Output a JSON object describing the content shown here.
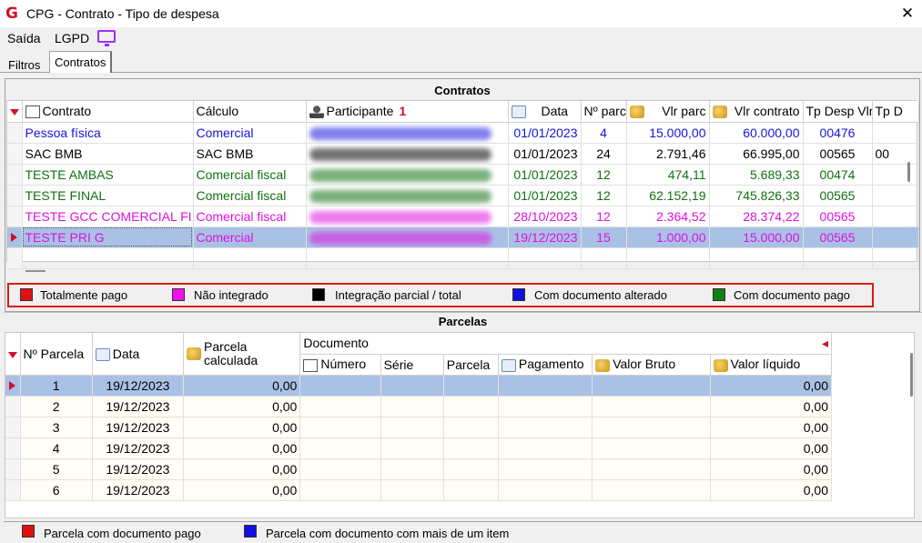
{
  "window": {
    "title": "CPG - Contrato - Tipo de despesa",
    "close_glyph": "✕",
    "logo_glyph": "G"
  },
  "menu": {
    "saida": "Saída",
    "lgpd": "LGPD"
  },
  "tabs": {
    "filtros": "Filtros",
    "contratos": "Contratos"
  },
  "contratos": {
    "title": "Contratos",
    "columns": [
      "Contrato",
      "Cálculo",
      "Participante",
      "Data",
      "Nº parc",
      "Vlr parc",
      "Vlr contrato",
      "Tp Desp Vlr",
      "Tp D"
    ],
    "sort_marker": "1",
    "rows": [
      {
        "contrato": "Pessoa física",
        "calculo": "Comercial",
        "data": "01/01/2023",
        "nparc": "4",
        "vlr_parc": "15.000,00",
        "vlr_contrato": "60.000,00",
        "tp_desp": "00476",
        "tp_d": "",
        "color": "#1515e0"
      },
      {
        "contrato": "SAC BMB",
        "calculo": "SAC BMB",
        "data": "01/01/2023",
        "nparc": "24",
        "vlr_parc": "2.791,46",
        "vlr_contrato": "66.995,00",
        "tp_desp": "00565",
        "tp_d": "00",
        "color": "#000000"
      },
      {
        "contrato": "TESTE AMBAS",
        "calculo": "Comercial fiscal",
        "data": "01/01/2023",
        "nparc": "12",
        "vlr_parc": "474,11",
        "vlr_contrato": "5.689,33",
        "tp_desp": "00474",
        "tp_d": "",
        "color": "#107010"
      },
      {
        "contrato": "TESTE FINAL",
        "calculo": "Comercial fiscal",
        "data": "01/01/2023",
        "nparc": "12",
        "vlr_parc": "62.152,19",
        "vlr_contrato": "745.826,33",
        "tp_desp": "00565",
        "tp_d": "",
        "color": "#107010"
      },
      {
        "contrato": "TESTE GCC COMERCIAL FI...",
        "calculo": "Comercial fiscal",
        "data": "28/10/2023",
        "nparc": "12",
        "vlr_parc": "2.364,52",
        "vlr_contrato": "28.374,22",
        "tp_desp": "00565",
        "tp_d": "",
        "color": "#e010e0"
      },
      {
        "contrato": "TESTE PRI G",
        "calculo": "Comercial",
        "data": "19/12/2023",
        "nparc": "15",
        "vlr_parc": "1.000,00",
        "vlr_contrato": "15.000,00",
        "tp_desp": "00565",
        "tp_d": "",
        "color": "#e010e0"
      }
    ]
  },
  "legend": [
    {
      "label": "Totalmente pago",
      "color": "#e01010"
    },
    {
      "label": "Não integrado",
      "color": "#f010f0"
    },
    {
      "label": "Integração parcial / total",
      "color": "#000000"
    },
    {
      "label": "Com documento alterado",
      "color": "#1010e0"
    },
    {
      "label": "Com documento pago",
      "color": "#108010"
    }
  ],
  "parcelas": {
    "title": "Parcelas",
    "col_nparcela": "Nº Parcela",
    "col_data": "Data",
    "col_parcela_calc_1": "Parcela",
    "col_parcela_calc_2": "calculada",
    "group_documento": "Documento",
    "doc_cols": [
      "Número",
      "Série",
      "Parcela",
      "Pagamento",
      "Valor Bruto",
      "Valor líquido"
    ],
    "rows": [
      {
        "n": "1",
        "data": "19/12/2023",
        "calc": "0,00",
        "liquido": "0,00"
      },
      {
        "n": "2",
        "data": "19/12/2023",
        "calc": "0,00",
        "liquido": "0,00"
      },
      {
        "n": "3",
        "data": "19/12/2023",
        "calc": "0,00",
        "liquido": "0,00"
      },
      {
        "n": "4",
        "data": "19/12/2023",
        "calc": "0,00",
        "liquido": "0,00"
      },
      {
        "n": "5",
        "data": "19/12/2023",
        "calc": "0,00",
        "liquido": "0,00"
      },
      {
        "n": "6",
        "data": "19/12/2023",
        "calc": "0,00",
        "liquido": "0,00"
      }
    ]
  },
  "bottom_legend": [
    {
      "label": "Parcela com documento pago",
      "color": "#e01010"
    },
    {
      "label": "Parcela com documento com mais de um item",
      "color": "#1010e0"
    }
  ]
}
